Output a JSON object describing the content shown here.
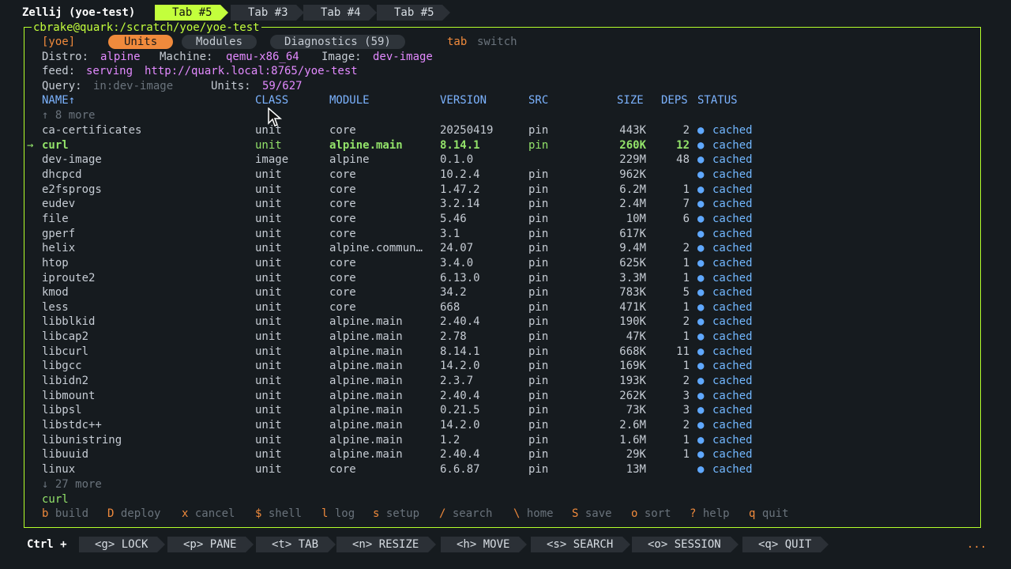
{
  "zellij": {
    "session": "Zellij (yoe-test)",
    "tabs": [
      "Tab #5",
      "Tab #3",
      "Tab #4",
      "Tab #5"
    ],
    "active_tab": 0
  },
  "pane": {
    "title": "cbrake@quark:/scratch/yoe/yoe-test"
  },
  "app": {
    "name": "[yoe]",
    "tabs": [
      "Units",
      "Modules",
      "Diagnostics (59)"
    ],
    "tab_hint_key": "tab",
    "tab_hint_text": "switch"
  },
  "info": {
    "distro_label": "Distro:",
    "distro": "alpine",
    "machine_label": "Machine:",
    "machine": "qemu-x86_64",
    "image_label": "Image:",
    "image": "dev-image",
    "feed_label": "feed:",
    "feed_status": "serving",
    "feed_url": "http://quark.local:8765/yoe-test",
    "query_label": "Query:",
    "query": "in:dev-image",
    "units_label": "Units:",
    "units": "59/627"
  },
  "table": {
    "headers": [
      "NAME↑",
      "CLASS",
      "MODULE",
      "VERSION",
      "SRC",
      "SIZE",
      "DEPS",
      "STATUS"
    ],
    "more_above": "↑ 8 more",
    "more_below": "↓ 27 more",
    "selected_index": 1,
    "selected_marker": "→",
    "rows": [
      [
        "ca-certificates",
        "unit",
        "core",
        "20250419",
        "pin",
        "443K",
        "2",
        "cached"
      ],
      [
        "curl",
        "unit",
        "alpine.main",
        "8.14.1",
        "pin",
        "260K",
        "12",
        "cached"
      ],
      [
        "dev-image",
        "image",
        "alpine",
        "0.1.0",
        "",
        "229M",
        "48",
        "cached"
      ],
      [
        "dhcpcd",
        "unit",
        "core",
        "10.2.4",
        "pin",
        "962K",
        "",
        "cached"
      ],
      [
        "e2fsprogs",
        "unit",
        "core",
        "1.47.2",
        "pin",
        "6.2M",
        "1",
        "cached"
      ],
      [
        "eudev",
        "unit",
        "core",
        "3.2.14",
        "pin",
        "2.4M",
        "7",
        "cached"
      ],
      [
        "file",
        "unit",
        "core",
        "5.46",
        "pin",
        "10M",
        "6",
        "cached"
      ],
      [
        "gperf",
        "unit",
        "core",
        "3.1",
        "pin",
        "617K",
        "",
        "cached"
      ],
      [
        "helix",
        "unit",
        "alpine.commun…",
        "24.07",
        "pin",
        "9.4M",
        "2",
        "cached"
      ],
      [
        "htop",
        "unit",
        "core",
        "3.4.0",
        "pin",
        "625K",
        "1",
        "cached"
      ],
      [
        "iproute2",
        "unit",
        "core",
        "6.13.0",
        "pin",
        "3.3M",
        "1",
        "cached"
      ],
      [
        "kmod",
        "unit",
        "core",
        "34.2",
        "pin",
        "783K",
        "5",
        "cached"
      ],
      [
        "less",
        "unit",
        "core",
        "668",
        "pin",
        "471K",
        "1",
        "cached"
      ],
      [
        "libblkid",
        "unit",
        "alpine.main",
        "2.40.4",
        "pin",
        "190K",
        "2",
        "cached"
      ],
      [
        "libcap2",
        "unit",
        "alpine.main",
        "2.78",
        "pin",
        "47K",
        "1",
        "cached"
      ],
      [
        "libcurl",
        "unit",
        "alpine.main",
        "8.14.1",
        "pin",
        "668K",
        "11",
        "cached"
      ],
      [
        "libgcc",
        "unit",
        "alpine.main",
        "14.2.0",
        "pin",
        "169K",
        "1",
        "cached"
      ],
      [
        "libidn2",
        "unit",
        "alpine.main",
        "2.3.7",
        "pin",
        "193K",
        "2",
        "cached"
      ],
      [
        "libmount",
        "unit",
        "alpine.main",
        "2.40.4",
        "pin",
        "262K",
        "3",
        "cached"
      ],
      [
        "libpsl",
        "unit",
        "alpine.main",
        "0.21.5",
        "pin",
        "73K",
        "3",
        "cached"
      ],
      [
        "libstdc++",
        "unit",
        "alpine.main",
        "14.2.0",
        "pin",
        "2.6M",
        "2",
        "cached"
      ],
      [
        "libunistring",
        "unit",
        "alpine.main",
        "1.2",
        "pin",
        "1.6M",
        "1",
        "cached"
      ],
      [
        "libuuid",
        "unit",
        "alpine.main",
        "2.40.4",
        "pin",
        "29K",
        "1",
        "cached"
      ],
      [
        "linux",
        "unit",
        "core",
        "6.6.87",
        "pin",
        "13M",
        "",
        "cached"
      ]
    ],
    "status_dot": "●"
  },
  "status_line": "curl",
  "keys": [
    {
      "k": "b",
      "label": "build"
    },
    {
      "k": "D",
      "label": "deploy"
    },
    {
      "k": "x",
      "label": "cancel"
    },
    {
      "k": "$",
      "label": "shell"
    },
    {
      "k": "l",
      "label": "log"
    },
    {
      "k": "s",
      "label": "setup"
    },
    {
      "k": "/",
      "label": "search"
    },
    {
      "k": "\\",
      "label": "home"
    },
    {
      "k": "S",
      "label": "save"
    },
    {
      "k": "o",
      "label": "sort"
    },
    {
      "k": "?",
      "label": "help"
    },
    {
      "k": "q",
      "label": "quit"
    }
  ],
  "bottombar": {
    "ctrl": "Ctrl +",
    "items": [
      "<g> LOCK",
      "<p> PANE",
      "<t> TAB",
      "<n> RESIZE",
      "<h> MOVE",
      "<s> SEARCH",
      "<o> SESSION",
      "<q> QUIT"
    ],
    "ellipsis": "..."
  },
  "colors": {
    "accent": "#c3ff3c",
    "border": "#b4ff2a",
    "orange": "#f08a3c",
    "pink": "#e38aff",
    "header": "#7cb3ff"
  }
}
